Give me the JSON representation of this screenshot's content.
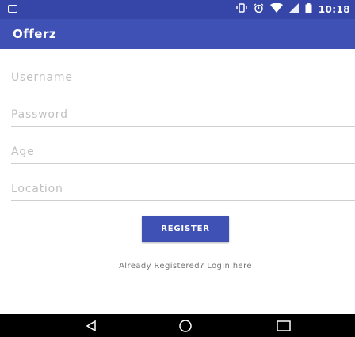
{
  "status_bar": {
    "time": "10:18",
    "icons": [
      "notification-icon",
      "vibrate-icon",
      "alarm-icon",
      "wifi-icon",
      "signal-icon",
      "battery-icon"
    ]
  },
  "app_bar": {
    "title": "Offerz"
  },
  "form": {
    "username_placeholder": "Username",
    "password_placeholder": "Password",
    "age_placeholder": "Age",
    "location_placeholder": "Location",
    "register_label": "REGISTER",
    "login_link": "Already Registered? Login here"
  },
  "nav_bar": {
    "icons": [
      "back-icon",
      "home-icon",
      "recents-icon"
    ]
  },
  "colors": {
    "primary": "#3f51b5",
    "primary_dark": "#3545a8"
  }
}
